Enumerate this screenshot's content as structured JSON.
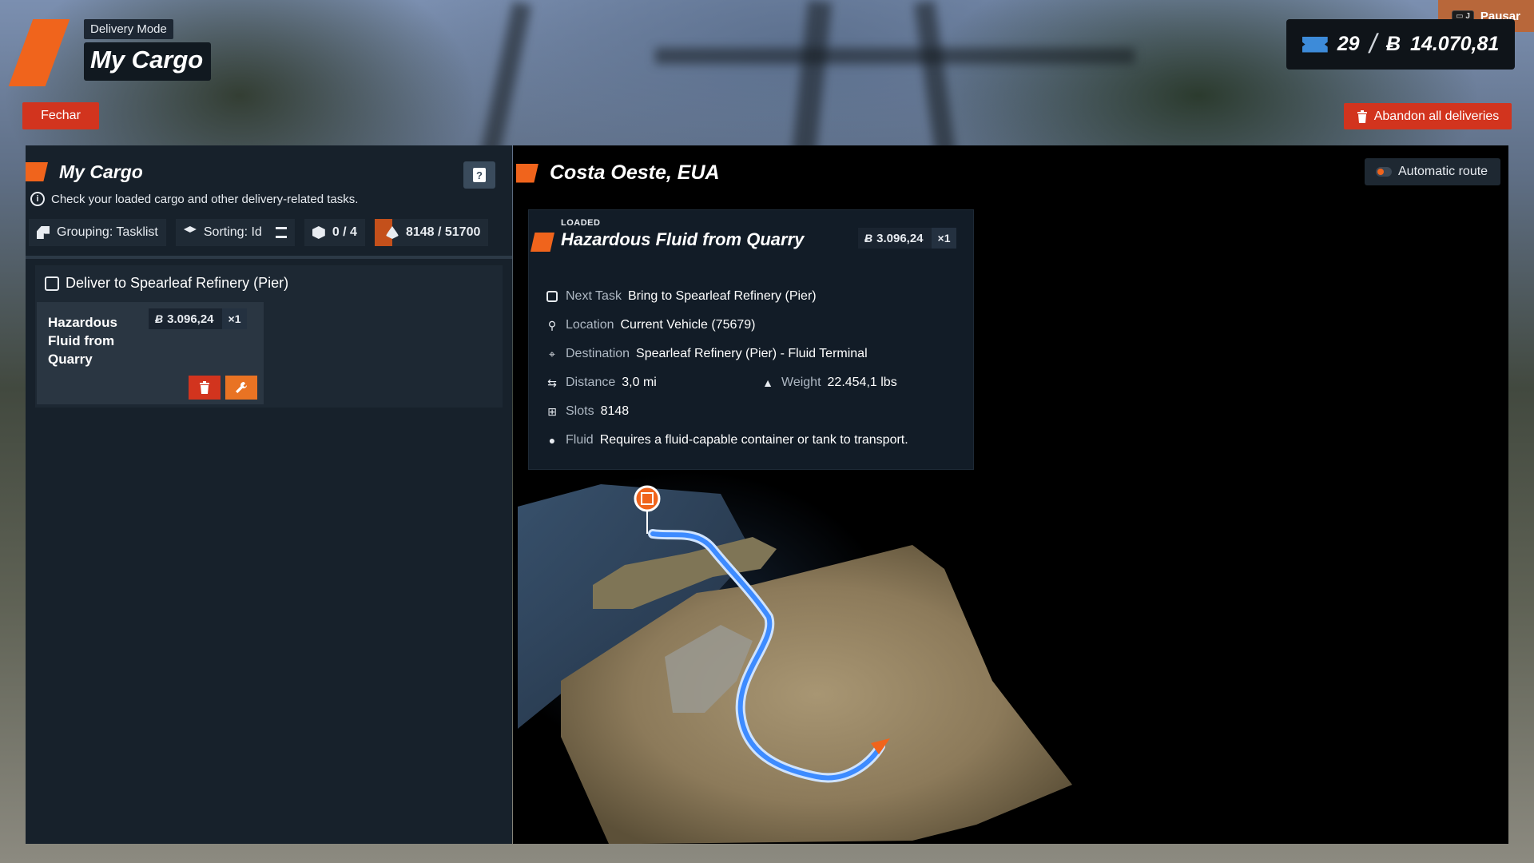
{
  "header": {
    "mode_label": "Delivery Mode",
    "title": "My Cargo",
    "close_label": "Fechar"
  },
  "top_right": {
    "pause_label": "Pausar",
    "pause_key": "J",
    "tickets": "29",
    "balance": "14.070,81",
    "abandon_label": "Abandon all deliveries"
  },
  "left_panel": {
    "title": "My Cargo",
    "description": "Check your loaded cargo and other delivery-related tasks.",
    "toolbar": {
      "grouping": "Grouping: Tasklist",
      "sorting": "Sorting: Id",
      "cargo_count": "0 / 4",
      "fluid_capacity": "8148 / 51700"
    },
    "task_group": {
      "title": "Deliver to Spearleaf Refinery (Pier)",
      "cargo": {
        "name": "Hazardous Fluid from Quarry",
        "price": "3.096,24",
        "qty": "×1"
      }
    }
  },
  "right_panel": {
    "region": "Costa Oeste, EUA",
    "auto_route_label": "Automatic route",
    "detail": {
      "status": "LOADED",
      "title": "Hazardous Fluid from Quarry",
      "price": "3.096,24",
      "qty": "×1",
      "next_task_label": "Next Task",
      "next_task": "Bring to Spearleaf Refinery (Pier)",
      "location_label": "Location",
      "location": "Current Vehicle (75679)",
      "destination_label": "Destination",
      "destination": "Spearleaf Refinery (Pier) - Fluid Terminal",
      "distance_label": "Distance",
      "distance": "3,0 mi",
      "weight_label": "Weight",
      "weight": "22.454,1 lbs",
      "slots_label": "Slots",
      "slots": "8148",
      "fluid_label": "Fluid",
      "fluid": "Requires a fluid-capable container or tank to transport."
    }
  },
  "colors": {
    "accent": "#f0641c",
    "danger": "#d2341e",
    "route": "#3d8bff",
    "panel": "#17212b"
  }
}
